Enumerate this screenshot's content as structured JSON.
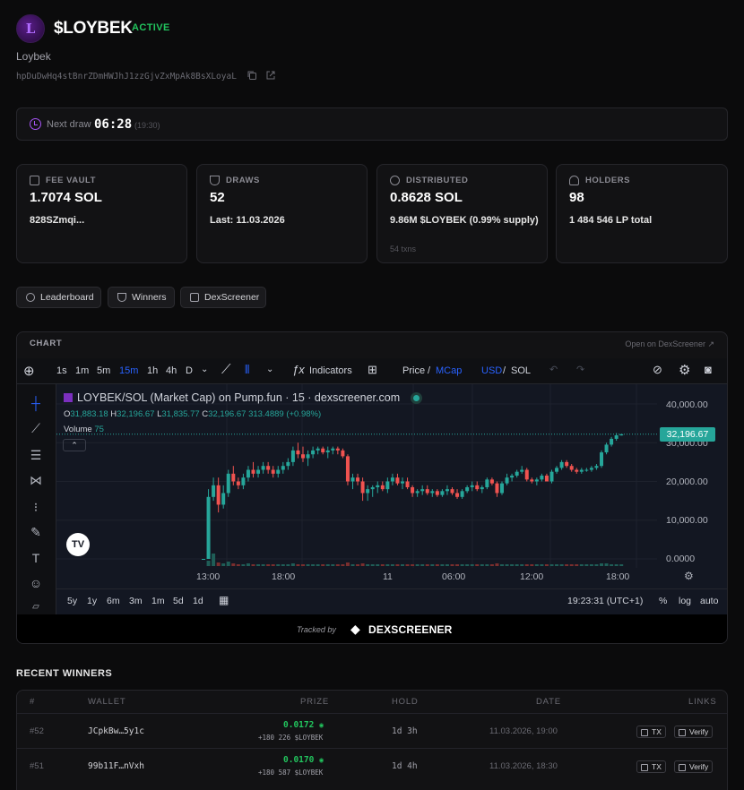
{
  "header": {
    "logo_letter": "L",
    "title": "$LOYBEK",
    "status": "ACTIVE",
    "subtitle": "Loybek",
    "address": "hpDuDwHq4stBnrZDmHWJhJ1zzGjvZxMpAk8BsXLoyaL"
  },
  "next_draw": {
    "label": "Next draw",
    "countdown": "06:28",
    "time": "(19:30)"
  },
  "stats": [
    {
      "icon": "vault-icon",
      "label": "FEE VAULT",
      "value": "1.7074 SOL",
      "sub": "828SZmqi...",
      "note": ""
    },
    {
      "icon": "trophy-icon",
      "label": "DRAWS",
      "value": "52",
      "sub": "Last: 11.03.2026",
      "note": ""
    },
    {
      "icon": "link-icon",
      "label": "DISTRIBUTED",
      "value": "0.8628 SOL",
      "sub": "9.86M $LOYBEK (0.99% supply)",
      "note": "54 txns"
    },
    {
      "icon": "users-icon",
      "label": "HOLDERS",
      "value": "98",
      "sub": "1 484 546 LP total",
      "note": ""
    }
  ],
  "buttons": {
    "leaderboard": "Leaderboard",
    "winners": "Winners",
    "dexscreener": "DexScreener"
  },
  "chart_panel": {
    "label": "CHART",
    "open_link": "Open on DexScreener",
    "toolbar": {
      "intervals": [
        "1s",
        "1m",
        "5m",
        "15m",
        "1h",
        "4h",
        "D"
      ],
      "active_interval": "15m",
      "indicators": "Indicators",
      "price": "Price",
      "slash": "/",
      "mcap": "MCap",
      "usd": "USD",
      "sol": "SOL"
    },
    "title": "LOYBEK/SOL (Market Cap) on Pump.fun · 15 · dexscreener.com",
    "ohlc": {
      "o_label": "O",
      "o": "31,883.18",
      "h_label": "H",
      "h": "32,196.67",
      "l_label": "L",
      "l": "31,835.77",
      "c_label": "C",
      "c": "32,196.67",
      "chg": "313.4889 (+0.98%)"
    },
    "volume_label": "Volume",
    "volume_value": "75",
    "last_price": "32,196.67",
    "bottom": {
      "ranges": [
        "5y",
        "1y",
        "6m",
        "3m",
        "1m",
        "5d",
        "1d"
      ],
      "clock": "19:23:31 (UTC+1)",
      "pct": "%",
      "log": "log",
      "auto": "auto"
    },
    "tracked_by": "Tracked by",
    "brand": "DEXSCREENER"
  },
  "chart_data": {
    "type": "candlestick",
    "ylim": [
      0,
      42000
    ],
    "y_ticks": [
      "40,000.00",
      "30,000.00",
      "20,000.00",
      "10,000.00",
      "0.0000"
    ],
    "x_ticks": [
      "13:00",
      "18:00",
      "11",
      "06:00",
      "12:00",
      "18:00"
    ],
    "last_value": 32196.67,
    "candles": [
      [
        0,
        0,
        0,
        0
      ],
      [
        0,
        18000,
        0,
        16000
      ],
      [
        16000,
        21000,
        15000,
        19000
      ],
      [
        19000,
        21000,
        12000,
        14000
      ],
      [
        14000,
        19000,
        13000,
        17000
      ],
      [
        17000,
        23000,
        16000,
        22000
      ],
      [
        22000,
        24000,
        19000,
        20000
      ],
      [
        20000,
        21000,
        18000,
        19000
      ],
      [
        19000,
        22000,
        18000,
        21000
      ],
      [
        21000,
        24000,
        20000,
        23000
      ],
      [
        23000,
        25000,
        21000,
        22000
      ],
      [
        22000,
        24000,
        21000,
        23000
      ],
      [
        23000,
        25000,
        22000,
        24000
      ],
      [
        24000,
        25000,
        22000,
        23000
      ],
      [
        23000,
        24000,
        21000,
        22000
      ],
      [
        22000,
        24000,
        21000,
        23000
      ],
      [
        23000,
        25000,
        22000,
        24000
      ],
      [
        24000,
        26000,
        23000,
        25000
      ],
      [
        25000,
        29000,
        24000,
        28000
      ],
      [
        28000,
        30000,
        26000,
        27000
      ],
      [
        27000,
        29000,
        25000,
        26000
      ],
      [
        26000,
        28000,
        24000,
        27000
      ],
      [
        27000,
        29000,
        26000,
        28000
      ],
      [
        28000,
        29000,
        27000,
        28500
      ],
      [
        28500,
        29000,
        27000,
        27500
      ],
      [
        27500,
        29000,
        26000,
        28000
      ],
      [
        28000,
        29000,
        27000,
        28500
      ],
      [
        28500,
        29000,
        27000,
        28000
      ],
      [
        28000,
        28500,
        26000,
        26500
      ],
      [
        26500,
        27000,
        19000,
        20000
      ],
      [
        20000,
        22000,
        18000,
        21000
      ],
      [
        21000,
        22000,
        19000,
        20000
      ],
      [
        20000,
        21000,
        15000,
        17000
      ],
      [
        17000,
        19000,
        15000,
        18000
      ],
      [
        18000,
        19000,
        16000,
        18500
      ],
      [
        18500,
        20000,
        17000,
        19000
      ],
      [
        19000,
        20000,
        17500,
        18000
      ],
      [
        18000,
        21000,
        17000,
        20000
      ],
      [
        20000,
        22000,
        19000,
        21000
      ],
      [
        21000,
        22000,
        19000,
        19500
      ],
      [
        19500,
        21000,
        18000,
        20000
      ],
      [
        20000,
        21000,
        18000,
        18500
      ],
      [
        18500,
        19000,
        16000,
        17000
      ],
      [
        17000,
        18000,
        16000,
        17500
      ],
      [
        17500,
        19000,
        16500,
        18000
      ],
      [
        18000,
        19000,
        16500,
        17000
      ],
      [
        17000,
        18000,
        16000,
        17500
      ],
      [
        17500,
        18000,
        16000,
        16500
      ],
      [
        16500,
        18000,
        16000,
        17500
      ],
      [
        17500,
        19000,
        16500,
        18000
      ],
      [
        18000,
        18500,
        16500,
        17000
      ],
      [
        17000,
        18000,
        15500,
        16000
      ],
      [
        16000,
        18000,
        15500,
        17500
      ],
      [
        17500,
        19000,
        17000,
        18500
      ],
      [
        18500,
        20000,
        17500,
        19000
      ],
      [
        19000,
        20000,
        17500,
        18000
      ],
      [
        18000,
        19000,
        17000,
        18500
      ],
      [
        18500,
        21000,
        18000,
        20500
      ],
      [
        20500,
        21000,
        19000,
        19500
      ],
      [
        19500,
        20000,
        16000,
        17000
      ],
      [
        17000,
        20000,
        16500,
        19500
      ],
      [
        19500,
        22000,
        19000,
        21000
      ],
      [
        21000,
        22000,
        20000,
        21500
      ],
      [
        21500,
        23000,
        21000,
        22500
      ],
      [
        22500,
        24000,
        22000,
        23000
      ],
      [
        23000,
        23500,
        20000,
        20500
      ],
      [
        20500,
        21000,
        19500,
        20000
      ],
      [
        20000,
        21000,
        19000,
        20500
      ],
      [
        20500,
        22000,
        20000,
        21500
      ],
      [
        21500,
        22000,
        20000,
        20000
      ],
      [
        20000,
        23000,
        19500,
        22500
      ],
      [
        22500,
        24000,
        22000,
        23500
      ],
      [
        23500,
        25500,
        23000,
        25000
      ],
      [
        25000,
        25500,
        23500,
        24000
      ],
      [
        24000,
        24500,
        22500,
        23000
      ],
      [
        23000,
        23500,
        22000,
        22500
      ],
      [
        22500,
        23500,
        22000,
        23000
      ],
      [
        23000,
        23500,
        22500,
        23000
      ],
      [
        23000,
        24000,
        22500,
        23500
      ],
      [
        23500,
        24500,
        23000,
        24000
      ],
      [
        24000,
        28000,
        23500,
        27500
      ],
      [
        27500,
        30000,
        27000,
        29500
      ],
      [
        29500,
        31500,
        29000,
        31000
      ],
      [
        31000,
        32500,
        30500,
        31900
      ],
      [
        31883,
        32197,
        31836,
        32197
      ]
    ],
    "volumes": [
      0,
      6,
      14,
      4,
      3,
      5,
      3,
      2,
      2,
      3,
      2,
      2,
      2,
      2,
      2,
      2,
      2,
      2,
      3,
      2,
      2,
      2,
      2,
      2,
      2,
      2,
      2,
      2,
      2,
      4,
      2,
      2,
      3,
      2,
      2,
      2,
      2,
      2,
      2,
      2,
      2,
      2,
      2,
      2,
      2,
      2,
      2,
      2,
      2,
      2,
      2,
      2,
      2,
      2,
      2,
      2,
      2,
      2,
      2,
      3,
      2,
      2,
      2,
      2,
      2,
      2,
      2,
      2,
      2,
      2,
      2,
      2,
      2,
      2,
      2,
      2,
      2,
      2,
      2,
      2,
      3,
      3,
      2,
      2,
      2
    ]
  },
  "winners": {
    "title": "RECENT WINNERS",
    "columns": [
      "#",
      "WALLET",
      "PRIZE",
      "HOLD",
      "DATE",
      "LINKS"
    ],
    "rows": [
      {
        "n": "#52",
        "wallet": "JCpkBw…5y1c",
        "prize": "0.0172",
        "tokens": "+180 226 $LOYBEK",
        "hold": "1d 3h",
        "date": "11.03.2026, 19:00",
        "tx": "TX",
        "verify": "Verify"
      },
      {
        "n": "#51",
        "wallet": "99b11F…nVxh",
        "prize": "0.0170",
        "tokens": "+180 587 $LOYBEK",
        "hold": "1d 4h",
        "date": "11.03.2026, 18:30",
        "tx": "TX",
        "verify": "Verify"
      }
    ]
  }
}
